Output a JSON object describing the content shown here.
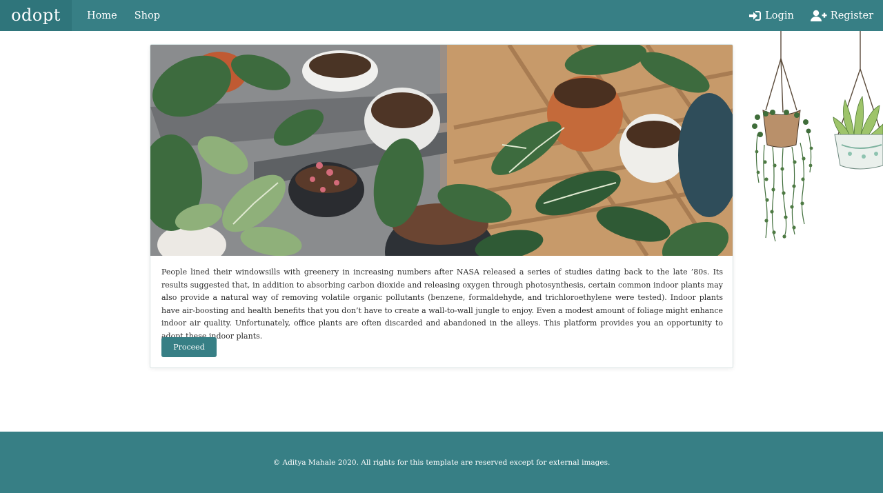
{
  "navbar": {
    "brand": "odopt",
    "links": [
      {
        "label": "Home"
      },
      {
        "label": "Shop"
      }
    ],
    "login_label": "Login",
    "register_label": "Register"
  },
  "card": {
    "description": "People lined their windowsills with greenery in increasing numbers after NASA released a series of studies dating back to the late ’80s. Its results suggested that, in addition to absorbing carbon dioxide and releasing oxygen through photosynthesis, certain common indoor plants may also provide a natural way of removing volatile organic pollutants (benzene, formaldehyde, and trichloroethylene were tested). Indoor plants have air-boosting and health benefits that you don’t have to create a wall-to-wall jungle to enjoy. Even a modest amount of foliage might enhance indoor air quality. Unfortunately, office plants are often discarded and abandoned in the alleys. This platform provides you an opportunity to adopt these indoor plants.",
    "button_label": "Proceed"
  },
  "footer": {
    "text": "© Aditya Mahale 2020. All rights for this template are reserved except for external images."
  },
  "icons": {
    "login": "sign-in-icon",
    "register": "user-plus-icon"
  },
  "colors": {
    "primary": "#377f85",
    "brand_bg": "#2f757b"
  }
}
